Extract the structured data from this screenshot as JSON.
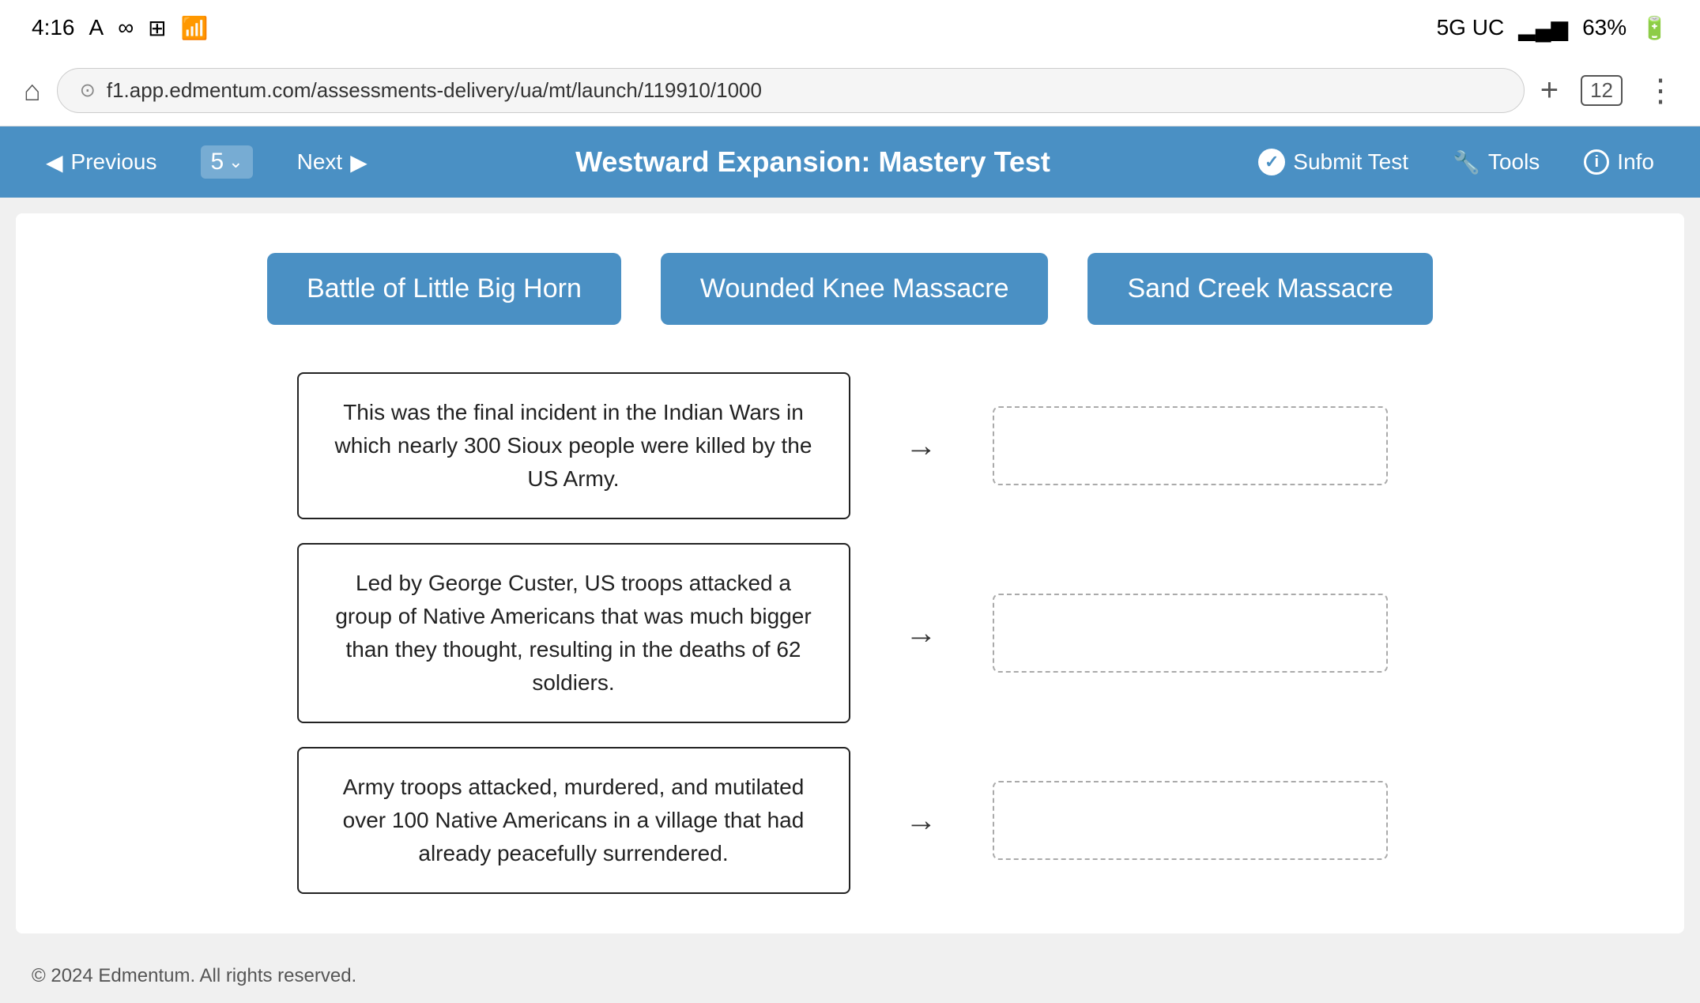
{
  "status_bar": {
    "time": "4:16",
    "signal": "5G UC",
    "battery": "63%"
  },
  "browser": {
    "url": "f1.app.edmentum.com/assessments-delivery/ua/mt/launch/119910/1000",
    "tab_count": "12"
  },
  "nav": {
    "previous_label": "Previous",
    "question_number": "5",
    "next_label": "Next",
    "title": "Westward Expansion: Mastery Test",
    "submit_label": "Submit Test",
    "tools_label": "Tools",
    "info_label": "Info"
  },
  "drag_labels": [
    {
      "id": "lbl1",
      "text": "Battle of Little Big Horn"
    },
    {
      "id": "lbl2",
      "text": "Wounded Knee Massacre"
    },
    {
      "id": "lbl3",
      "text": "Sand Creek Massacre"
    }
  ],
  "clues": [
    {
      "id": "clue1",
      "text": "This was the final incident in the Indian Wars in which nearly 300 Sioux people were killed by the US Army."
    },
    {
      "id": "clue2",
      "text": "Led by George Custer, US troops attacked a group of Native Americans that was much bigger than they thought, resulting in the deaths of 62 soldiers."
    },
    {
      "id": "clue3",
      "text": "Army troops attacked, murdered, and mutilated over 100 Native Americans in a village that had already peacefully surrendered."
    }
  ],
  "footer": {
    "copyright": "© 2024 Edmentum. All rights reserved."
  }
}
